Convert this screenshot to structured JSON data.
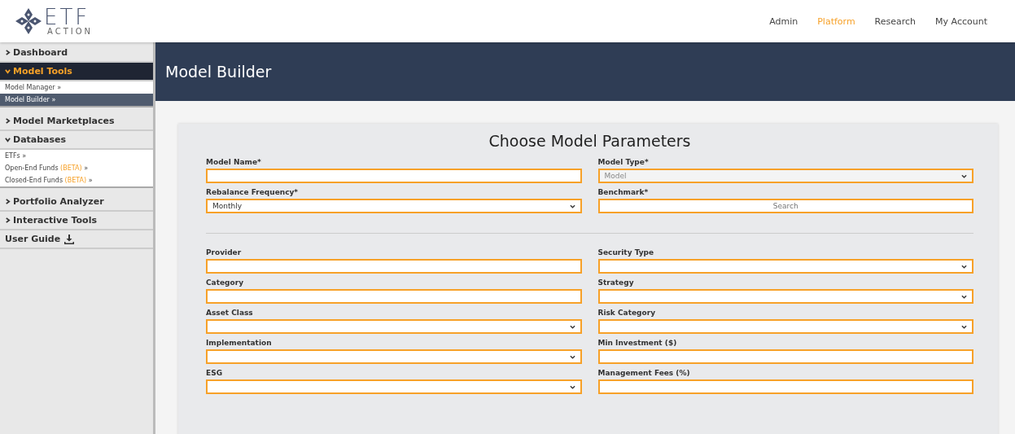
{
  "brand": {
    "name": "ETF",
    "tagline": "ACTION"
  },
  "nav": [
    {
      "label": "Admin",
      "selected": false
    },
    {
      "label": "Platform",
      "selected": true
    },
    {
      "label": "Research",
      "selected": false
    },
    {
      "label": "My Account",
      "selected": false
    }
  ],
  "sidebar": [
    {
      "label": "Dashboard",
      "kind": "section",
      "expanded": false,
      "selected": false
    },
    {
      "label": "Model Tools",
      "kind": "section",
      "expanded": true,
      "selected": true,
      "children": [
        {
          "label": "Model Manager",
          "suffix": "»",
          "selected": false
        },
        {
          "label": "Model Builder",
          "suffix": "»",
          "selected": true
        }
      ]
    },
    {
      "label": "Model Marketplaces",
      "kind": "section",
      "expanded": false,
      "selected": false
    },
    {
      "label": "Databases",
      "kind": "section",
      "expanded": true,
      "selected": false,
      "children": [
        {
          "label": "ETFs",
          "suffix": "»",
          "selected": false
        },
        {
          "label": "Open-End Funds",
          "tag": "(BETA)",
          "suffix": "»",
          "selected": false
        },
        {
          "label": "Closed-End Funds",
          "tag": "(BETA)",
          "suffix": "»",
          "selected": false
        }
      ]
    },
    {
      "label": "Portfolio Analyzer",
      "kind": "section",
      "expanded": false,
      "selected": false
    },
    {
      "label": "Interactive Tools",
      "kind": "section",
      "expanded": false,
      "selected": false
    },
    {
      "label": "User Guide",
      "kind": "download"
    }
  ],
  "page_title": "Model Builder",
  "form": {
    "title": "Choose Model Parameters",
    "required_fields": [
      {
        "label": "Model Name*",
        "kind": "text"
      },
      {
        "label": "Model Type*",
        "kind": "select",
        "value": "Model",
        "disabled": true
      },
      {
        "label": "Rebalance Frequency*",
        "kind": "select",
        "value": "Monthly",
        "disabled": false
      },
      {
        "label": "Benchmark*",
        "kind": "search",
        "placeholder": "Search"
      }
    ],
    "filters": [
      {
        "label": "Provider",
        "kind": "text"
      },
      {
        "label": "Security Type",
        "kind": "select",
        "disabled": false
      },
      {
        "label": "Category",
        "kind": "text"
      },
      {
        "label": "Strategy",
        "kind": "select",
        "disabled": false
      },
      {
        "label": "Asset Class",
        "kind": "select",
        "disabled": false
      },
      {
        "label": "Risk Category",
        "kind": "select",
        "disabled": false
      },
      {
        "label": "Implementation",
        "kind": "select",
        "disabled": false
      },
      {
        "label": "Min Investment ($)",
        "kind": "text"
      },
      {
        "label": "ESG",
        "kind": "select",
        "disabled": false
      },
      {
        "label": "Management Fees (%)",
        "kind": "text"
      }
    ]
  }
}
